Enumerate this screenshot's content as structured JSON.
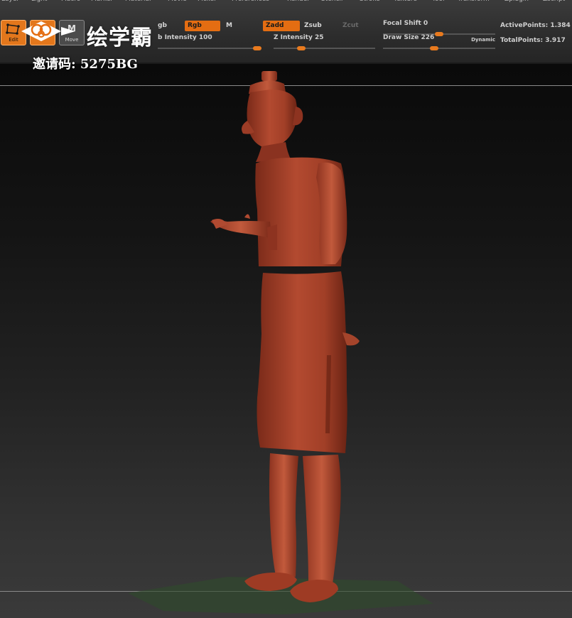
{
  "menu": {
    "items": [
      "Layer",
      "Light",
      "Macro",
      "Marker",
      "Material",
      "Movie",
      "Picker",
      "Preferences",
      "Render",
      "Stencil",
      "Stroke",
      "Texture",
      "Tool",
      "Transform",
      "Zplugin",
      "Zscript"
    ]
  },
  "tools": {
    "edit_label": "Edit",
    "move_label": "Move",
    "move_glyph": "M"
  },
  "toolbar": {
    "mrgb_label": "gb",
    "rgb_label": "Rgb",
    "m_label": "M",
    "zadd_label": "Zadd",
    "zsub_label": "Zsub",
    "zcut_label": "Zcut",
    "rgb_intensity_label": "b Intensity 100",
    "z_intensity_label": "Z Intensity 25",
    "focal_shift_label": "Focal Shift 0",
    "draw_size_label": "Draw Size 226",
    "dynamic_label": "Dynamic",
    "active_points_label": "ActivePoints: 1.384",
    "total_points_label": "TotalPoints: 3.917",
    "accent_color": "#e46d12"
  },
  "sliders": {
    "rgb_intensity": 100,
    "z_intensity": 25,
    "focal_shift": 0,
    "draw_size": 226
  },
  "watermark": {
    "brand_text": "绘学霸",
    "invite_text": "邀请码: 5275BG"
  },
  "viewport": {
    "model_color": "#a8432c",
    "floor_grid_color": "#3f6b3a"
  }
}
